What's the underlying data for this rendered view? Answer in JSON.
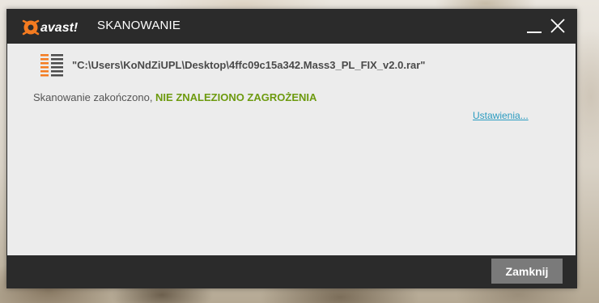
{
  "window": {
    "brand": "avast!",
    "title": "SKANOWANIE",
    "controls": {
      "minimize_icon": "minimize-icon",
      "close_icon": "close-icon"
    }
  },
  "scan": {
    "file_path": "\"C:\\Users\\KoNdZiUPL\\Desktop\\4ffc09c15a342.Mass3_PL_FIX_v2.0.rar\"",
    "status_prefix": "Skanowanie zakończono, ",
    "status_result": "NIE ZNALEZIONO ZAGROŻENIA",
    "settings_link": "Ustawienia..."
  },
  "footer": {
    "close_button": "Zamknij"
  },
  "colors": {
    "brand_orange": "#f47b20",
    "status_green": "#6d9a0f",
    "link_blue": "#2a9bc0",
    "titlebar_bg": "#2b2b2b",
    "content_bg": "#ececec",
    "button_bg": "#7a7a7a"
  },
  "icons": {
    "logo": "avast-logo",
    "file": "file-list-icon"
  }
}
